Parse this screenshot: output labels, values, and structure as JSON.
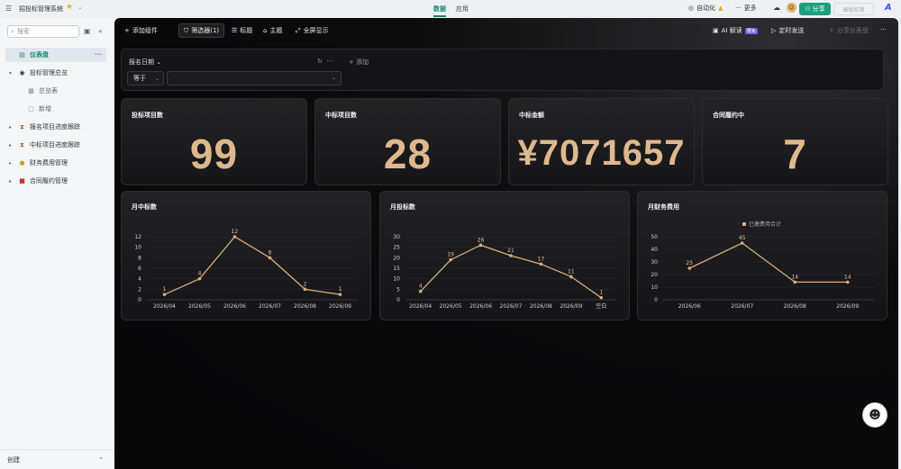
{
  "app": {
    "title": "招投标管理系统",
    "tabs": [
      {
        "label": "数据",
        "active": true
      },
      {
        "label": "应用",
        "active": false
      }
    ],
    "right": {
      "automation": "自动化",
      "more": "更多",
      "share": "分享",
      "permission": "高级权限"
    }
  },
  "sidebar": {
    "search_placeholder": "搜索",
    "items": [
      {
        "label": "仪表盘",
        "active": true,
        "icon": "dashboard-icon",
        "depth": 0
      },
      {
        "label": "投标管理总览",
        "icon": "target-icon",
        "depth": 0,
        "expanded": true
      },
      {
        "label": "总览表",
        "icon": "table-icon",
        "depth": 1
      },
      {
        "label": "新增",
        "icon": "form-icon",
        "depth": 1
      },
      {
        "label": "报名项目进度跟踪",
        "icon": "hourglass-icon",
        "depth": 0
      },
      {
        "label": "中标项目进度跟踪",
        "icon": "hourglass-icon",
        "depth": 0
      },
      {
        "label": "财务费用管理",
        "icon": "money-bag-icon",
        "depth": 0
      },
      {
        "label": "合同履约管理",
        "icon": "book-icon",
        "depth": 0
      }
    ],
    "bottom_label": "创建"
  },
  "toolbar": {
    "add_widget": "添加组件",
    "filter": "筛选器(1)",
    "title": "标题",
    "theme": "主题",
    "fullscreen": "全屏显示",
    "ai_read": "AI 解读",
    "ai_badge": "限免",
    "schedule": "定时发送",
    "share_dashboard": "分享仪表盘"
  },
  "filter": {
    "field": "报名日期",
    "add": "添加",
    "operator": "等于",
    "value": ""
  },
  "stats": [
    {
      "title": "投标项目数",
      "value": "99"
    },
    {
      "title": "中标项目数",
      "value": "28"
    },
    {
      "title": "中标金额",
      "value": "¥7071657"
    },
    {
      "title": "合同履约中",
      "value": "7"
    }
  ],
  "chart_data": [
    {
      "type": "line",
      "title": "月中标数",
      "categories": [
        "2026/04",
        "2026/05",
        "2026/06",
        "2026/07",
        "2026/08",
        "2026/09"
      ],
      "values": [
        1,
        4,
        12,
        8,
        2,
        1
      ],
      "yticks": [
        0,
        2,
        4,
        6,
        8,
        10,
        12
      ],
      "ylim": [
        0,
        12
      ],
      "legend": null
    },
    {
      "type": "line",
      "title": "月投标数",
      "categories": [
        "2026/04",
        "2026/05",
        "2026/06",
        "2026/07",
        "2026/08",
        "2026/09",
        "空白"
      ],
      "values": [
        4,
        19,
        26,
        21,
        17,
        11,
        1
      ],
      "yticks": [
        0,
        5,
        10,
        15,
        20,
        25,
        30
      ],
      "ylim": [
        0,
        30
      ],
      "legend": null
    },
    {
      "type": "line",
      "title": "月财务费用",
      "categories": [
        "2026/06",
        "2026/07",
        "2026/08",
        "2026/09"
      ],
      "values": [
        25,
        45,
        14,
        14
      ],
      "yticks": [
        0,
        10,
        20,
        30,
        40,
        50
      ],
      "ylim": [
        0,
        50
      ],
      "legend": "已缴费用合计"
    }
  ],
  "colors": {
    "accent": "#1d9e7e",
    "line": "#d9ad7c",
    "value": "#e0b88d"
  }
}
